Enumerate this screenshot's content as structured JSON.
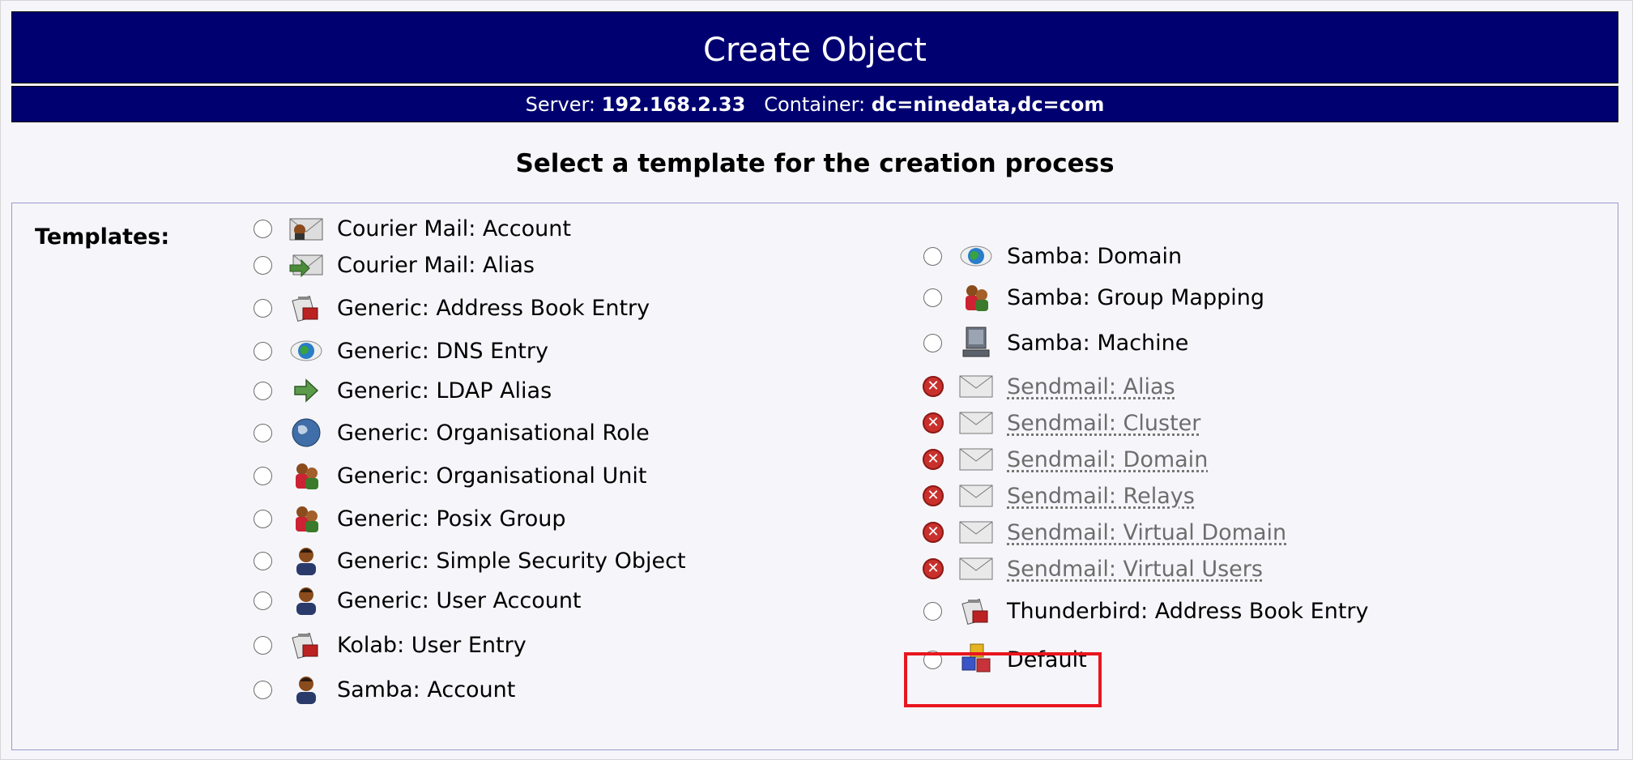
{
  "header": {
    "title": "Create Object",
    "server_label": "Server:",
    "server_value": "192.168.2.33",
    "container_label": "Container:",
    "container_value": "dc=ninedata,dc=com"
  },
  "heading": "Select a template for the creation process",
  "templates_label": "Templates:",
  "left_templates": [
    {
      "label": "Courier Mail: Account",
      "icon": "mail-account-icon"
    },
    {
      "label": "Courier Mail: Alias",
      "icon": "mail-alias-icon"
    },
    {
      "label": "Generic: Address Book Entry",
      "icon": "address-book-icon"
    },
    {
      "label": "Generic: DNS Entry",
      "icon": "dns-icon"
    },
    {
      "label": "Generic: LDAP Alias",
      "icon": "arrow-right-icon"
    },
    {
      "label": "Generic: Organisational Role",
      "icon": "globe-icon"
    },
    {
      "label": "Generic: Organisational Unit",
      "icon": "group-icon"
    },
    {
      "label": "Generic: Posix Group",
      "icon": "group-icon"
    },
    {
      "label": "Generic: Simple Security Object",
      "icon": "user-icon"
    },
    {
      "label": "Generic: User Account",
      "icon": "user-icon"
    },
    {
      "label": "Kolab: User Entry",
      "icon": "address-book-icon"
    },
    {
      "label": "Samba: Account",
      "icon": "user-icon"
    }
  ],
  "right_templates": [
    {
      "label": "Samba: Domain",
      "icon": "dns-icon",
      "enabled": true
    },
    {
      "label": "Samba: Group Mapping",
      "icon": "group-icon",
      "enabled": true
    },
    {
      "label": "Samba: Machine",
      "icon": "computer-icon",
      "enabled": true
    },
    {
      "label": "Sendmail: Alias",
      "icon": "envelope-icon",
      "enabled": false
    },
    {
      "label": "Sendmail: Cluster",
      "icon": "envelope-icon",
      "enabled": false
    },
    {
      "label": "Sendmail: Domain",
      "icon": "envelope-icon",
      "enabled": false
    },
    {
      "label": "Sendmail: Relays",
      "icon": "envelope-icon",
      "enabled": false
    },
    {
      "label": "Sendmail: Virtual Domain",
      "icon": "envelope-icon",
      "enabled": false
    },
    {
      "label": "Sendmail: Virtual Users",
      "icon": "envelope-icon",
      "enabled": false
    },
    {
      "label": "Thunderbird: Address Book Entry",
      "icon": "address-book-icon",
      "enabled": true
    },
    {
      "label": "Default",
      "icon": "cubes-icon",
      "enabled": true
    }
  ],
  "colors": {
    "header_bg": "#000070",
    "highlight": "#e8161f",
    "disabled_icon": "#c9302c"
  }
}
